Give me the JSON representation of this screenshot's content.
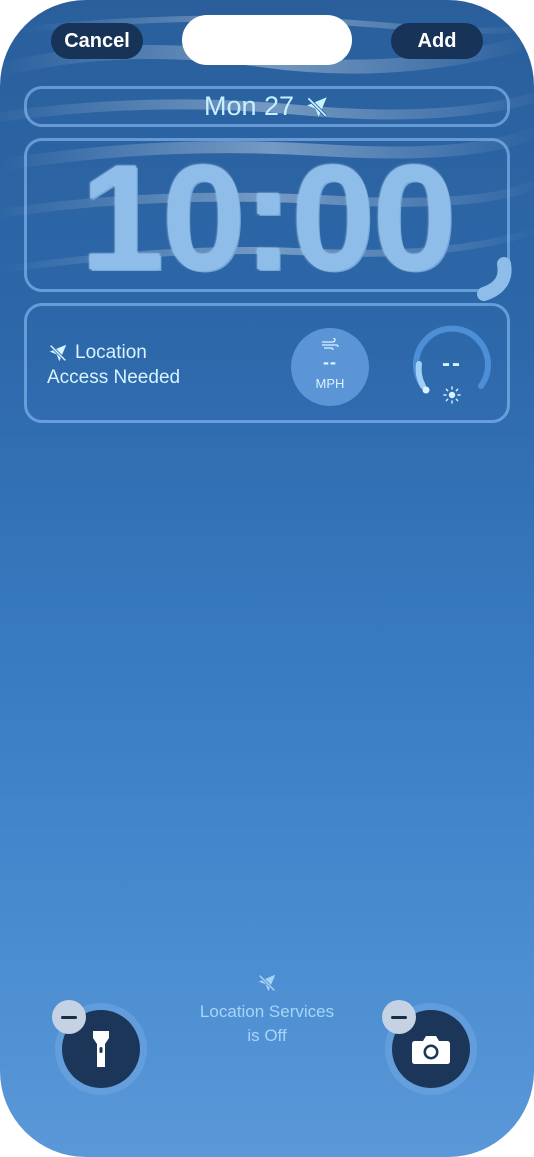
{
  "toolbar": {
    "cancel_label": "Cancel",
    "add_label": "Add"
  },
  "lock_screen": {
    "date": "Mon 27",
    "time": "10:00"
  },
  "widgets": {
    "location": {
      "line1": "Location",
      "line2": "Access Needed"
    },
    "wind": {
      "value": "--",
      "unit": "MPH"
    },
    "uv": {
      "value": "--"
    }
  },
  "location_status": {
    "line1": "Location Services",
    "line2": "is Off"
  },
  "quick_actions": {
    "left": "flashlight-icon",
    "right": "camera-icon"
  },
  "colors": {
    "accent_text": "#c7f0ff",
    "button_bg": "#173357"
  }
}
